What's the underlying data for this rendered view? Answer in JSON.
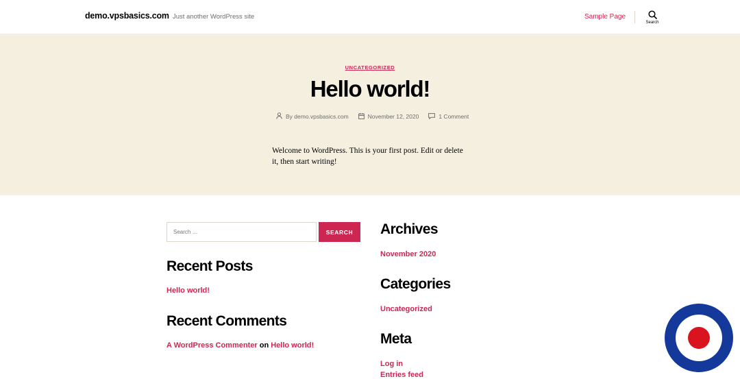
{
  "header": {
    "site_title": "demo.vpsbasics.com",
    "site_description": "Just another WordPress site",
    "nav_link": "Sample Page",
    "search_toggle_label": "Search"
  },
  "post": {
    "category": "UNCATEGORIZED",
    "title": "Hello world!",
    "author_prefix": "By ",
    "author": "demo.vpsbasics.com",
    "date": "November 12, 2020",
    "comments": "1 Comment",
    "content": "Welcome to WordPress. This is your first post. Edit or delete it, then start writing!"
  },
  "sidebar_left": {
    "search_placeholder": "Search …",
    "search_button": "SEARCH",
    "recent_posts_title": "Recent Posts",
    "recent_posts": [
      "Hello world!"
    ],
    "recent_comments_title": "Recent Comments",
    "comment_author": "A WordPress Commenter",
    "comment_on": "on",
    "comment_post": "Hello world!"
  },
  "sidebar_right": {
    "archives_title": "Archives",
    "archives": [
      "November 2020"
    ],
    "categories_title": "Categories",
    "categories": [
      "Uncategorized"
    ],
    "meta_title": "Meta",
    "meta_links": [
      "Log in",
      "Entries feed"
    ]
  },
  "colors": {
    "accent": "#cd2653",
    "hero_bg": "#f5efe0",
    "badge_outer": "#14399a",
    "badge_inner": "#d9141e"
  },
  "icons": [
    "search-icon",
    "user-icon",
    "calendar-icon",
    "comment-icon"
  ]
}
